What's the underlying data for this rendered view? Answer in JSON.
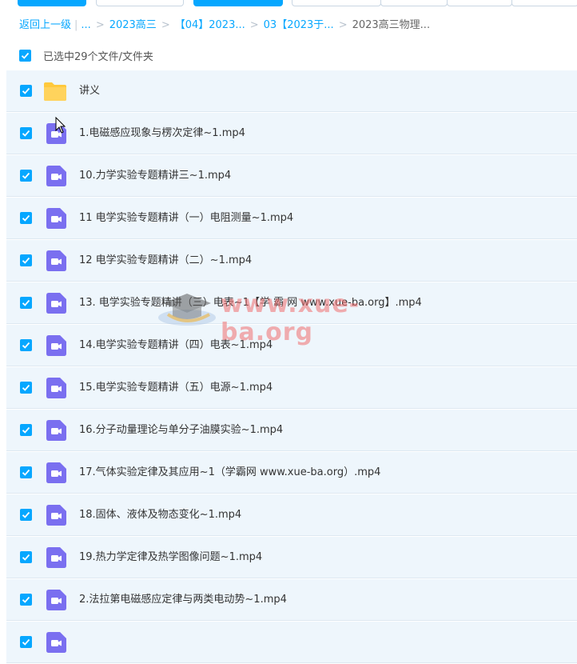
{
  "breadcrumb": {
    "back": "返回上一级",
    "ellipsis": "...",
    "items": [
      "2023高三",
      "【04】2023...",
      "03【2023于...",
      "2023高三物理..."
    ]
  },
  "selection": {
    "label": "已选中29个文件/文件夹",
    "checked": true
  },
  "files": [
    {
      "name": "讲义",
      "type": "folder",
      "checked": true
    },
    {
      "name": "1.电磁感应现象与楞次定律~1.mp4",
      "type": "video",
      "checked": true
    },
    {
      "name": "10.力学实验专题精讲三~1.mp4",
      "type": "video",
      "checked": true
    },
    {
      "name": "11 电学实验专题精讲（一）电阻测量~1.mp4",
      "type": "video",
      "checked": true
    },
    {
      "name": "12 电学实验专题精讲（二）~1.mp4",
      "type": "video",
      "checked": true
    },
    {
      "name": "13. 电学实验专题精讲（三）电表~1【学 霸 网 www.xue-ba.org】.mp4",
      "type": "video",
      "checked": true
    },
    {
      "name": "14.电学实验专题精讲（四）电表~1.mp4",
      "type": "video",
      "checked": true
    },
    {
      "name": "15.电学实验专题精讲（五）电源~1.mp4",
      "type": "video",
      "checked": true
    },
    {
      "name": "16.分子动量理论与单分子油膜实验~1.mp4",
      "type": "video",
      "checked": true
    },
    {
      "name": "17.气体实验定律及其应用~1（学霸网 www.xue-ba.org）.mp4",
      "type": "video",
      "checked": true
    },
    {
      "name": "18.固体、液体及物态变化~1.mp4",
      "type": "video",
      "checked": true
    },
    {
      "name": "19.热力学定律及热学图像问题~1.mp4",
      "type": "video",
      "checked": true
    },
    {
      "name": "2.法拉第电磁感应定律与两类电动势~1.mp4",
      "type": "video",
      "checked": true
    },
    {
      "name": "",
      "type": "video",
      "checked": true
    }
  ],
  "watermark": {
    "text": "www.xue-ba.org"
  },
  "colors": {
    "accent": "#06a7ff",
    "row_bg": "#eef6fc",
    "video_icon": "#7a6ff0",
    "folder": "#ffc93c"
  }
}
